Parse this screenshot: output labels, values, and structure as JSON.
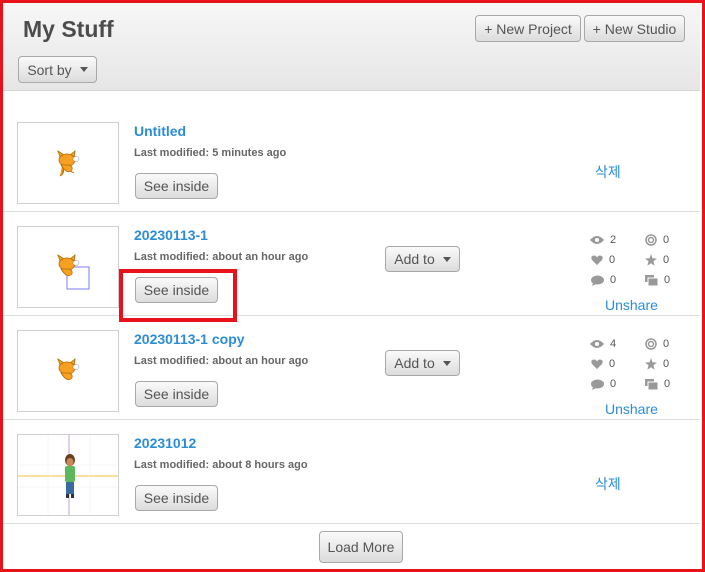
{
  "header": {
    "title": "My Stuff",
    "new_project_label": "+ New Project",
    "new_studio_label": "+ New Studio",
    "sort_label": "Sort by"
  },
  "projects": [
    {
      "title": "Untitled",
      "modified_prefix": "Last modified:",
      "modified_value": "5 minutes ago",
      "see_inside_label": "See inside",
      "action_label": "삭제"
    },
    {
      "title": "20230113-1",
      "modified_prefix": "Last modified:",
      "modified_value": "about an hour ago",
      "see_inside_label": "See inside",
      "add_to_label": "Add to",
      "stats": {
        "views": "2",
        "remixes": "0",
        "loves": "0",
        "favorites": "0",
        "comments": "0",
        "studios": "0"
      },
      "unshare_label": "Unshare"
    },
    {
      "title": "20230113-1 copy",
      "modified_prefix": "Last modified:",
      "modified_value": "about an hour ago",
      "see_inside_label": "See inside",
      "add_to_label": "Add to",
      "stats": {
        "views": "4",
        "remixes": "0",
        "loves": "0",
        "favorites": "0",
        "comments": "0",
        "studios": "0"
      },
      "unshare_label": "Unshare"
    },
    {
      "title": "20231012",
      "modified_prefix": "Last modified:",
      "modified_value": "about 8 hours ago",
      "see_inside_label": "See inside",
      "action_label": "삭제"
    }
  ],
  "load_more_label": "Load More",
  "colors": {
    "accent": "#2b8dd6",
    "highlight": "#e8121b",
    "cat": "#f7a021"
  }
}
